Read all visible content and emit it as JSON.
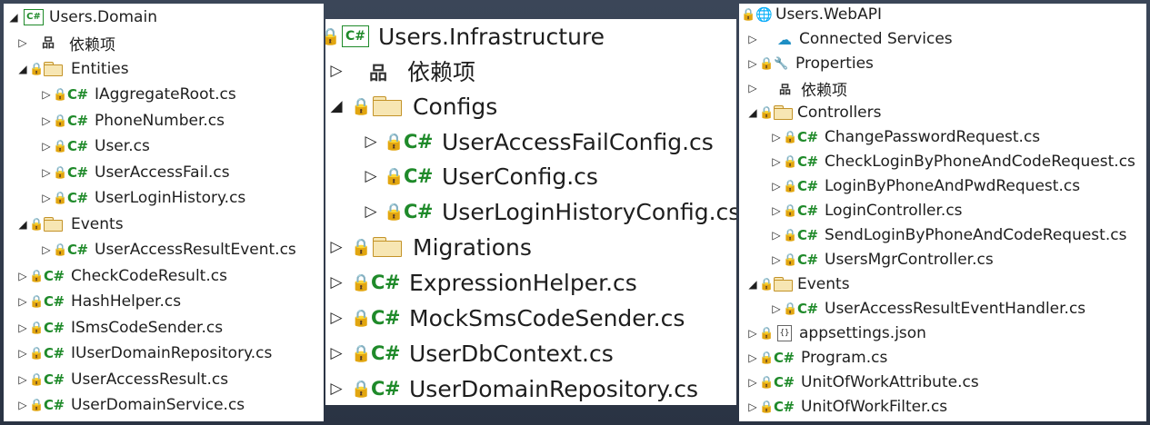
{
  "panels": {
    "domain": {
      "project": "Users.Domain",
      "project_icon": "C#",
      "dependencies": "依赖项",
      "entities_folder": "Entities",
      "entities": [
        "IAggregateRoot.cs",
        "PhoneNumber.cs",
        "User.cs",
        "UserAccessFail.cs",
        "UserLoginHistory.cs"
      ],
      "events_folder": "Events",
      "events": [
        "UserAccessResultEvent.cs"
      ],
      "files": [
        "CheckCodeResult.cs",
        "HashHelper.cs",
        "ISmsCodeSender.cs",
        "IUserDomainRepository.cs",
        "UserAccessResult.cs",
        "UserDomainService.cs"
      ]
    },
    "infra": {
      "project": "Users.Infrastructure",
      "project_icon": "C#",
      "dependencies": "依赖项",
      "configs_folder": "Configs",
      "configs": [
        "UserAccessFailConfig.cs",
        "UserConfig.cs",
        "UserLoginHistoryConfig.cs"
      ],
      "migrations_folder": "Migrations",
      "files": [
        "ExpressionHelper.cs",
        "MockSmsCodeSender.cs",
        "UserDbContext.cs",
        "UserDomainRepository.cs"
      ]
    },
    "web": {
      "project": "Users.WebAPI",
      "connected_services": "Connected Services",
      "properties": "Properties",
      "dependencies": "依赖项",
      "controllers_folder": "Controllers",
      "controllers": [
        "ChangePasswordRequest.cs",
        "CheckLoginByPhoneAndCodeRequest.cs",
        "LoginByPhoneAndPwdRequest.cs",
        "LoginController.cs",
        "SendLoginByPhoneAndCodeRequest.cs",
        "UsersMgrController.cs"
      ],
      "events_folder": "Events",
      "events": [
        "UserAccessResultEventHandler.cs"
      ],
      "appsettings": "appsettings.json",
      "json_icon": "{}",
      "files": [
        "Program.cs",
        "UnitOfWorkAttribute.cs",
        "UnitOfWorkFilter.cs"
      ]
    }
  },
  "glyphs": {
    "collapsed": "▷",
    "expanded": "◢",
    "lock": "🔒",
    "cs": "C#",
    "deps": "品",
    "wrench": "🔧",
    "globe": "🌐",
    "cloud": "☁"
  },
  "colors": {
    "csharp_green": "#1f8a2a",
    "lock_blue": "#2a66c8",
    "folder_fill": "#f7e6b3",
    "folder_border": "#c39329"
  }
}
